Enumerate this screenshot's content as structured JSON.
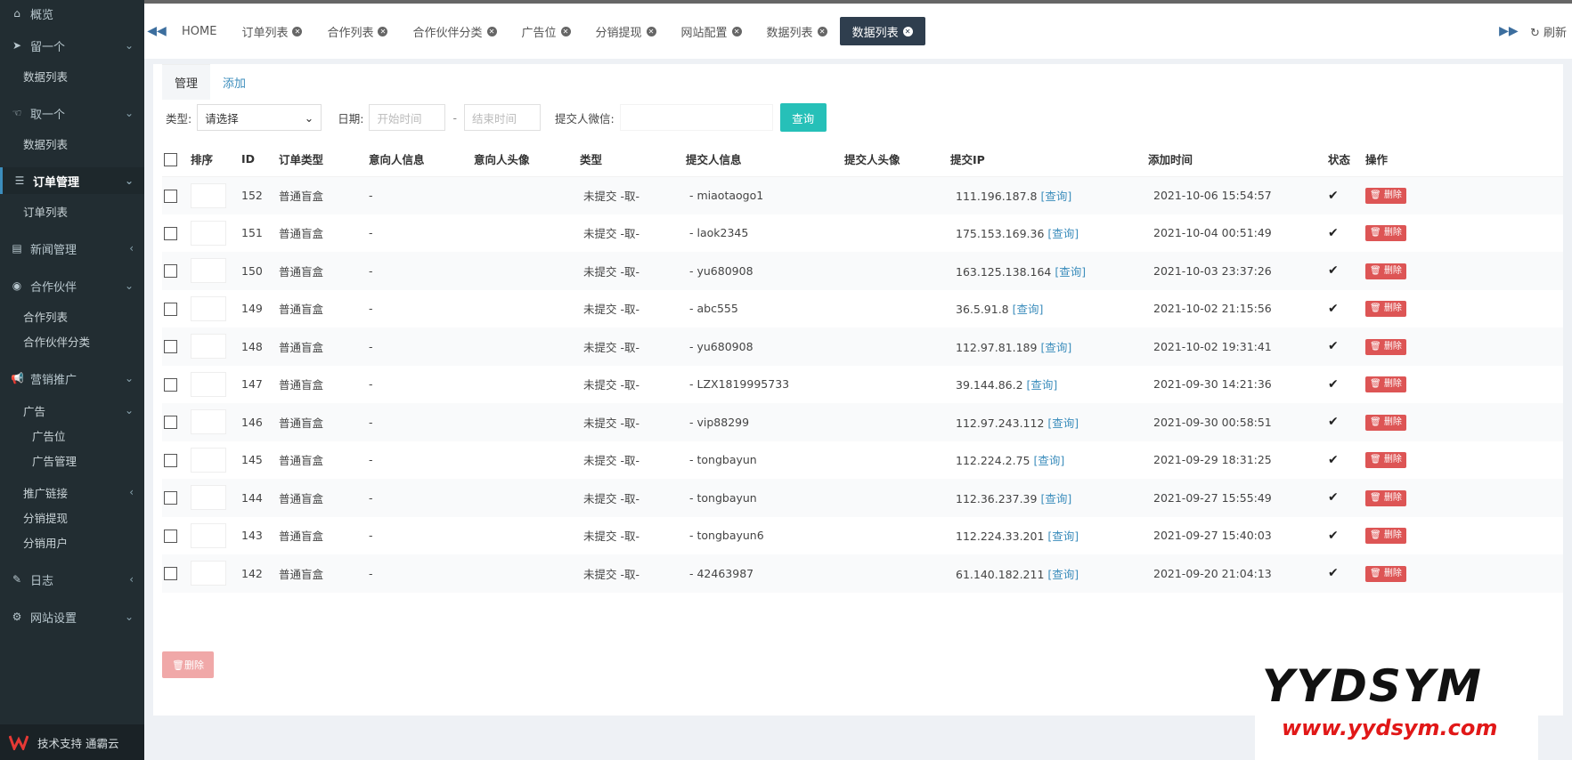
{
  "sidebar": {
    "items": [
      {
        "label": "概览",
        "icon": "home-icon",
        "type": "top"
      },
      {
        "label": "留一个",
        "icon": "send-icon",
        "type": "group",
        "chevron": "⌄"
      },
      {
        "label": "数据列表",
        "type": "sub"
      },
      {
        "label": "取一个",
        "icon": "hand-icon",
        "type": "group",
        "chevron": "⌄"
      },
      {
        "label": "数据列表",
        "type": "sub"
      },
      {
        "label": "订单管理",
        "icon": "list-icon",
        "type": "group",
        "chevron": "⌄",
        "active": true
      },
      {
        "label": "订单列表",
        "type": "sub"
      },
      {
        "label": "新闻管理",
        "icon": "news-icon",
        "type": "group",
        "chevron": "‹"
      },
      {
        "label": "合作伙伴",
        "icon": "eye-icon",
        "type": "group",
        "chevron": "⌄"
      },
      {
        "label": "合作列表",
        "type": "sub"
      },
      {
        "label": "合作伙伴分类",
        "type": "sub"
      },
      {
        "label": "营销推广",
        "icon": "bullhorn-icon",
        "type": "group",
        "chevron": "⌄"
      },
      {
        "label": "广告",
        "type": "sub",
        "chevron": "⌄"
      },
      {
        "label": "广告位",
        "type": "sub2"
      },
      {
        "label": "广告管理",
        "type": "sub2"
      },
      {
        "label": "推广链接",
        "type": "sub",
        "chevron": "‹"
      },
      {
        "label": "分销提现",
        "type": "sub"
      },
      {
        "label": "分销用户",
        "type": "sub"
      },
      {
        "label": "日志",
        "icon": "edit-icon",
        "type": "group",
        "chevron": "‹"
      },
      {
        "label": "网站设置",
        "icon": "sitemap-icon",
        "type": "group",
        "chevron": "⌄"
      }
    ],
    "footer": "技术支持 通霸云"
  },
  "topbar": {
    "tabs": [
      "HOME",
      "订单列表",
      "合作列表",
      "合作伙伴分类",
      "广告位",
      "分销提现",
      "网站配置",
      "数据列表",
      "数据列表"
    ],
    "active_tab_index": 8,
    "refresh_label": "刷新"
  },
  "subtabs": {
    "manage": "管理",
    "add": "添加"
  },
  "filters": {
    "type_label": "类型:",
    "type_value": "请选择",
    "date_label": "日期:",
    "start_placeholder": "开始时间",
    "separator": "-",
    "end_placeholder": "结束时间",
    "wechat_label": "提交人微信:",
    "query_button": "查询"
  },
  "table": {
    "headers": [
      "排序",
      "ID",
      "订单类型",
      "意向人信息",
      "意向人头像",
      "类型",
      "提交人信息",
      "提交人头像",
      "提交IP",
      "添加时间",
      "状态",
      "操作"
    ],
    "query_link": "[查询]",
    "delete_label": "删除",
    "rows": [
      {
        "id": "152",
        "order_type": "普通盲盒",
        "intent": "-",
        "kind": "未提交 -取-",
        "submitter": "- miaotaogo1",
        "ip": "111.196.187.8",
        "time": "2021-10-06 15:54:57"
      },
      {
        "id": "151",
        "order_type": "普通盲盒",
        "intent": "-",
        "kind": "未提交 -取-",
        "submitter": "- laok2345",
        "ip": "175.153.169.36",
        "time": "2021-10-04 00:51:49"
      },
      {
        "id": "150",
        "order_type": "普通盲盒",
        "intent": "-",
        "kind": "未提交 -取-",
        "submitter": "- yu680908",
        "ip": "163.125.138.164",
        "time": "2021-10-03 23:37:26"
      },
      {
        "id": "149",
        "order_type": "普通盲盒",
        "intent": "-",
        "kind": "未提交 -取-",
        "submitter": "- abc555",
        "ip": "36.5.91.8",
        "time": "2021-10-02 21:15:56"
      },
      {
        "id": "148",
        "order_type": "普通盲盒",
        "intent": "-",
        "kind": "未提交 -取-",
        "submitter": "- yu680908",
        "ip": "112.97.81.189",
        "time": "2021-10-02 19:31:41"
      },
      {
        "id": "147",
        "order_type": "普通盲盒",
        "intent": "-",
        "kind": "未提交 -取-",
        "submitter": "- LZX1819995733",
        "ip": "39.144.86.2",
        "time": "2021-09-30 14:21:36"
      },
      {
        "id": "146",
        "order_type": "普通盲盒",
        "intent": "-",
        "kind": "未提交 -取-",
        "submitter": "- vip88299",
        "ip": "112.97.243.112",
        "time": "2021-09-30 00:58:51"
      },
      {
        "id": "145",
        "order_type": "普通盲盒",
        "intent": "-",
        "kind": "未提交 -取-",
        "submitter": "- tongbayun",
        "ip": "112.224.2.75",
        "time": "2021-09-29 18:31:25"
      },
      {
        "id": "144",
        "order_type": "普通盲盒",
        "intent": "-",
        "kind": "未提交 -取-",
        "submitter": "- tongbayun",
        "ip": "112.36.237.39",
        "time": "2021-09-27 15:55:49"
      },
      {
        "id": "143",
        "order_type": "普通盲盒",
        "intent": "-",
        "kind": "未提交 -取-",
        "submitter": "- tongbayun6",
        "ip": "112.224.33.201",
        "time": "2021-09-27 15:40:03"
      },
      {
        "id": "142",
        "order_type": "普通盲盒",
        "intent": "-",
        "kind": "未提交 -取-",
        "submitter": "- 42463987",
        "ip": "61.140.182.211",
        "time": "2021-09-20 21:04:13"
      }
    ]
  },
  "bottom": {
    "delete_button": "删除"
  },
  "watermark": {
    "brand": "YYDSYM",
    "url": "www.yydsym.com"
  },
  "colors": {
    "sidebar_bg": "#222d32",
    "accent": "#26c0b8",
    "danger": "#dd5555",
    "active_tab": "#2f3e4e"
  }
}
